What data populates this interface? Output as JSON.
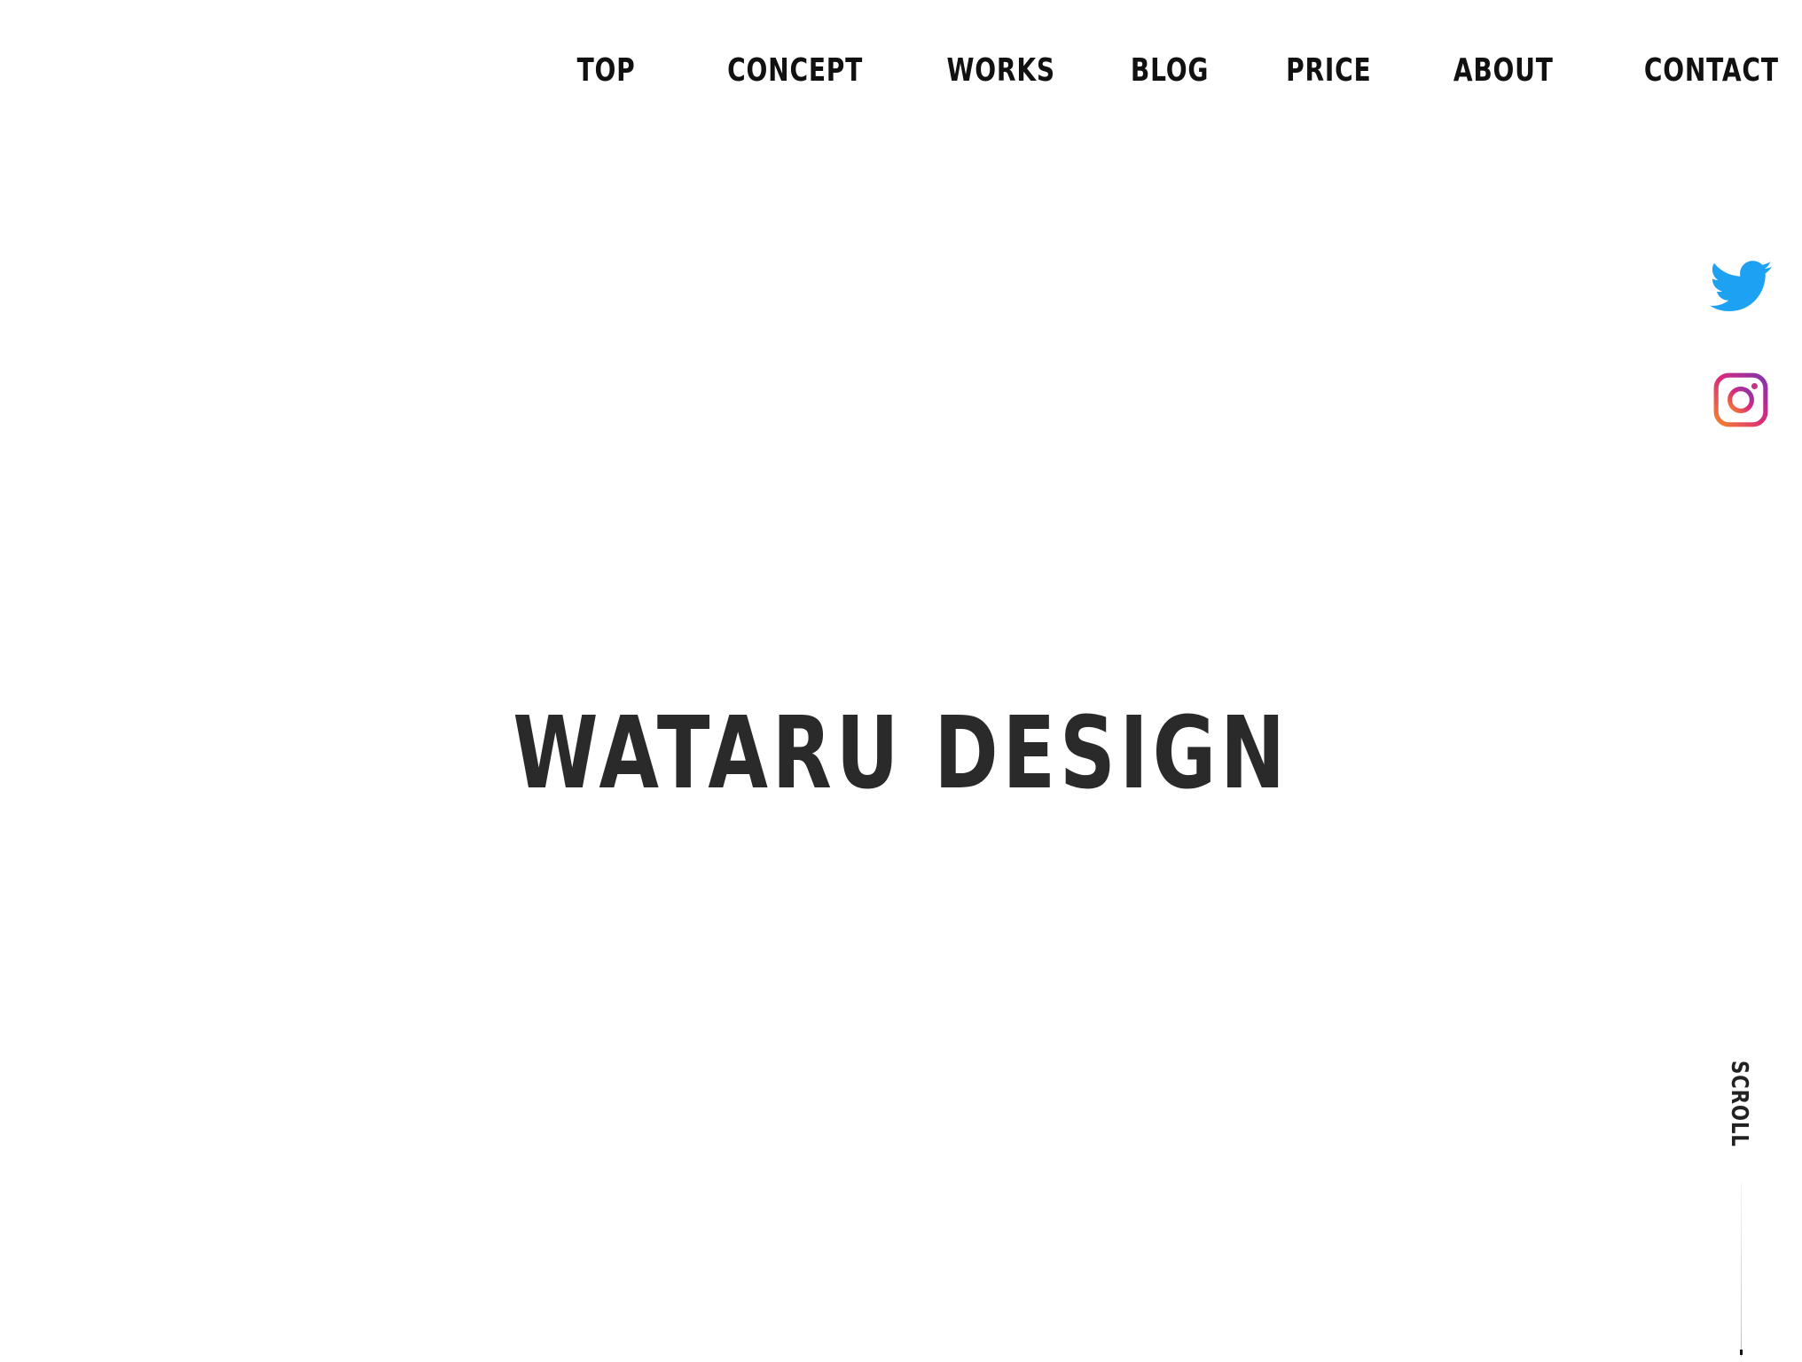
{
  "nav": {
    "items": [
      {
        "label": "TOP",
        "icon": ""
      },
      {
        "label": "CONCEPT",
        "icon": ""
      },
      {
        "label": "WORKS",
        "icon": ""
      },
      {
        "label": "BLOG",
        "icon": ""
      },
      {
        "label": "PRICE",
        "icon": ""
      },
      {
        "label": "ABOUT",
        "icon": ""
      },
      {
        "label": "CONTACT",
        "icon": ""
      }
    ]
  },
  "hero": {
    "title": "WATARU DESIGN"
  },
  "social": {
    "twitter": {
      "icon": "twitter-icon",
      "color": "#1DA1F2"
    },
    "instagram": {
      "icon": "instagram-icon",
      "colors": [
        "#F58529",
        "#DD2A7B",
        "#8134AF"
      ]
    }
  },
  "scroll": {
    "label": "SCROLL"
  }
}
